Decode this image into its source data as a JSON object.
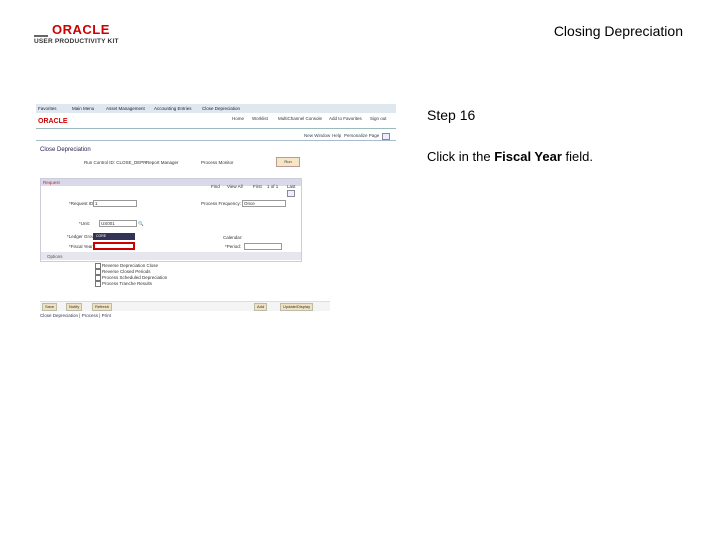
{
  "header": {
    "logo_brand": "ORACLE",
    "logo_product": "USER PRODUCTIVITY KIT",
    "document_title": "Closing Depreciation"
  },
  "screenshot": {
    "nav": [
      "Favorites",
      "Main Menu",
      "Asset Management",
      "Accounting Entries",
      "Close Depreciation"
    ],
    "brand": "ORACLE",
    "toplinks": [
      "Home",
      "Worklist",
      "MultiChannel Console",
      "Add to Favorites",
      "Sign out"
    ],
    "sublinks": [
      "New Window",
      "Help",
      "Personalize Page"
    ],
    "page_title": "Close Depreciation",
    "run_control": "Run Control ID: CLOSE_DEPR",
    "report_manager": "Report Manager",
    "process_monitor": "Process Monitor",
    "run_button": "Run",
    "panel_title": "Request",
    "nav_rowinfo": [
      "Find",
      "View All",
      "First",
      "1 of 1",
      "Last"
    ],
    "fields": {
      "request_id_label": "*Request ID:",
      "request_id_value": "1",
      "process_frequency_label": "Process Frequency:",
      "process_frequency_value": "Once",
      "unit_label": "*Unit:",
      "unit_value": "US001",
      "ledger_group_label": "*Ledger Group:",
      "ledger_group_value": "CORE",
      "fiscal_year_label": "*Fiscal Year:",
      "calendar_label": "Calendar:",
      "period_label": "*Period:"
    },
    "options_title": "Options",
    "options": [
      "Reverse Depreciation Close",
      "Reverse Closed Periods",
      "Process Scheduled Depreciation",
      "Process Tranche Results"
    ],
    "bottom_buttons": [
      "Save",
      "Notify",
      "Refresh",
      "Add",
      "Update/Display"
    ],
    "footer_links": "Close Depreciation | Process | Print"
  },
  "instructions": {
    "step": "Step 16",
    "prefix": "Click in the ",
    "bold": "Fiscal Year",
    "suffix": " field."
  }
}
